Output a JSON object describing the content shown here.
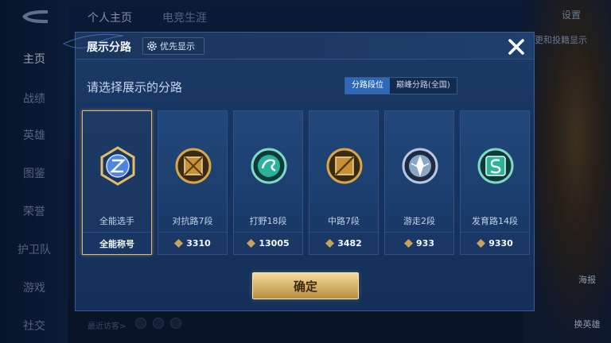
{
  "background": {
    "left_nav": [
      "主页",
      "战绩",
      "英雄",
      "图鉴",
      "荣誉",
      "护卫队",
      "游戏",
      "社交"
    ],
    "top_tabs": [
      "个人主页",
      "电竞生涯"
    ],
    "top_right": [
      "设置",
      "更和投籍显示"
    ],
    "visitor_label": "最近访客>",
    "right_buttons": [
      "海报",
      "换英雄"
    ]
  },
  "modal": {
    "title": "展示分路",
    "priority_label": "优先显示",
    "heading": "请选择展示的分路",
    "tabs": [
      {
        "label": "分路段位",
        "active": true
      },
      {
        "label": "巅峰分路(全国)",
        "active": false
      }
    ],
    "cards": [
      {
        "role": "全能选手",
        "score": "全能称号",
        "icon": "all-round-emblem-icon",
        "selected": true,
        "color": "#4d86e0"
      },
      {
        "role": "对抗路7段",
        "score": "3310",
        "icon": "clash-lane-emblem-icon",
        "selected": false,
        "color": "#c79235"
      },
      {
        "role": "打野18段",
        "score": "13005",
        "icon": "jungle-emblem-icon",
        "selected": false,
        "color": "#2bb29a"
      },
      {
        "role": "中路7段",
        "score": "3482",
        "icon": "mid-lane-emblem-icon",
        "selected": false,
        "color": "#c79235"
      },
      {
        "role": "游走2段",
        "score": "933",
        "icon": "roam-emblem-icon",
        "selected": false,
        "color": "#8aa6c9"
      },
      {
        "role": "发育路14段",
        "score": "9330",
        "icon": "farm-lane-emblem-icon",
        "selected": false,
        "color": "#2bb29a"
      }
    ],
    "confirm_label": "确定"
  },
  "colors": {
    "accent_gold": "#d8b46b",
    "active_tab_blue": "#2f68b7",
    "modal_bg": "#17345f"
  }
}
